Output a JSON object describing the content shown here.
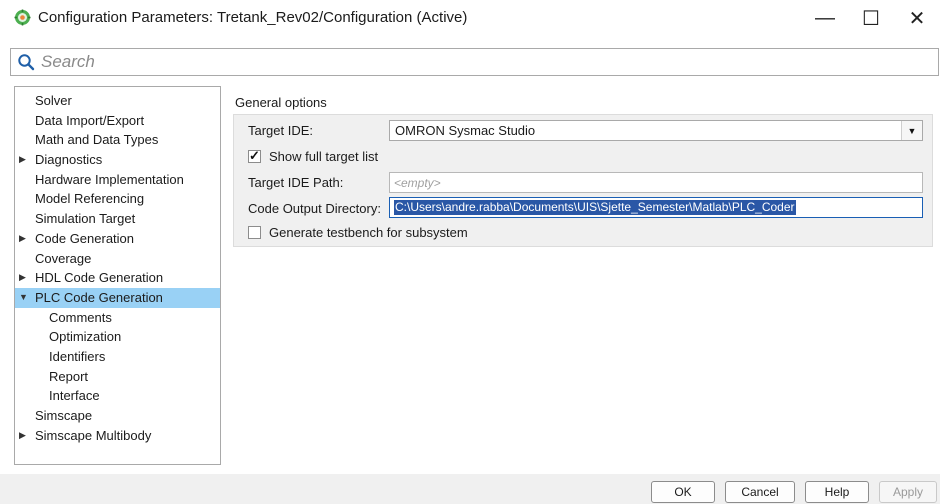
{
  "window": {
    "title": "Configuration Parameters: Tretank_Rev02/Configuration (Active)",
    "controls": {
      "minimize": "—",
      "maximize": "☐",
      "close": "✕"
    },
    "icon": "matlab-settings-icon"
  },
  "search": {
    "placeholder": "Search",
    "value": ""
  },
  "tree": {
    "items": [
      {
        "label": "Solver"
      },
      {
        "label": "Data Import/Export"
      },
      {
        "label": "Math and Data Types"
      },
      {
        "label": "Diagnostics",
        "arrow": "▶"
      },
      {
        "label": "Hardware Implementation"
      },
      {
        "label": "Model Referencing"
      },
      {
        "label": "Simulation Target"
      },
      {
        "label": "Code Generation",
        "arrow": "▶"
      },
      {
        "label": "Coverage"
      },
      {
        "label": "HDL Code Generation",
        "arrow": "▶"
      },
      {
        "label": "PLC Code Generation",
        "arrow": "▼",
        "selected": true
      },
      {
        "label": "Comments",
        "child": true
      },
      {
        "label": "Optimization",
        "child": true
      },
      {
        "label": "Identifiers",
        "child": true
      },
      {
        "label": "Report",
        "child": true
      },
      {
        "label": "Interface",
        "child": true
      },
      {
        "label": "Simscape"
      },
      {
        "label": "Simscape Multibody",
        "arrow": "▶"
      }
    ]
  },
  "general_options": {
    "section_label": "General options",
    "target_ide": {
      "label": "Target IDE:",
      "value": "OMRON Sysmac Studio",
      "dropdown_arrow": "▼"
    },
    "show_full_target_list": {
      "label": "Show full target list",
      "checked": true
    },
    "target_ide_path": {
      "label": "Target IDE Path:",
      "placeholder": "<empty>"
    },
    "code_output_directory": {
      "label": "Code Output Directory:",
      "value": "C:\\Users\\andre.rabba\\Documents\\UIS\\Sjette_Semester\\Matlab\\PLC_Coder"
    },
    "generate_testbench": {
      "label": "Generate testbench for subsystem",
      "checked": false
    }
  },
  "buttons": {
    "ok": "OK",
    "cancel": "Cancel",
    "help": "Help",
    "apply": "Apply"
  }
}
